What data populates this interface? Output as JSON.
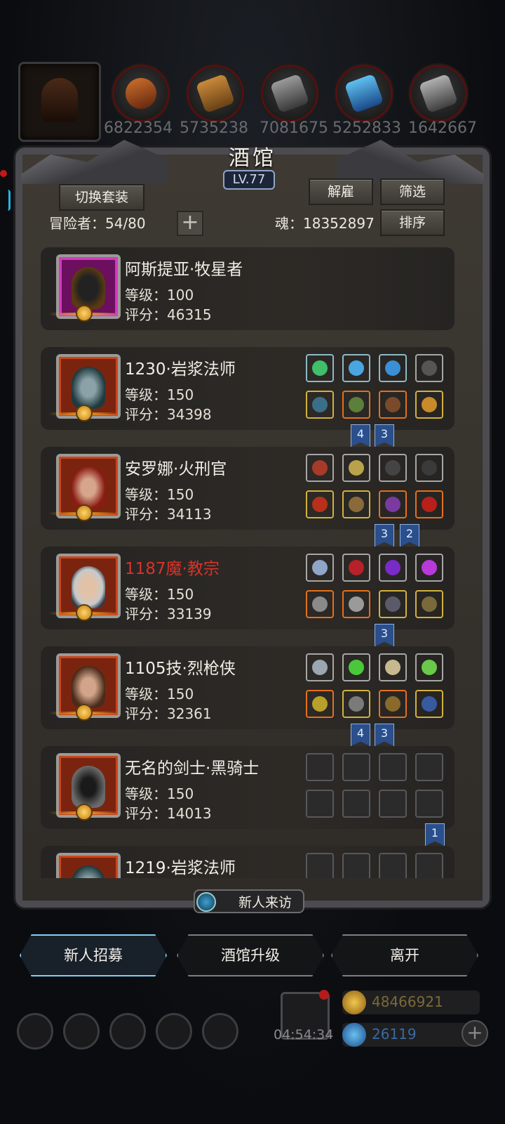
{
  "resources": {
    "values": [
      "6822354",
      "5735238",
      "7081675",
      "5252833",
      "1642667"
    ]
  },
  "panel": {
    "title": "酒馆",
    "level": "LV.77",
    "switch_outfit": "切换套装",
    "dismiss": "解雇",
    "filter": "筛选",
    "sort": "排序",
    "adventurer_label": "冒险者：54/80",
    "soul_label": "魂：18352897",
    "add_symbol": "+"
  },
  "heroes": [
    {
      "name": "阿斯提亚·牧星者",
      "level": "等级：100",
      "score": "评分：46315",
      "name_color": "#f2eee6",
      "frame": "magenta",
      "equipment": []
    },
    {
      "name": "1230·岩浆法师",
      "level": "等级：150",
      "score": "评分：34398",
      "name_color": "#f2eee6",
      "frame": "orange",
      "flags": [
        "4",
        "3"
      ]
    },
    {
      "name": "安罗娜·火刑官",
      "level": "等级：150",
      "score": "评分：34113",
      "name_color": "#f2eee6",
      "frame": "orange",
      "flags": [
        "3",
        "2"
      ]
    },
    {
      "name": "1187魔·教宗",
      "level": "等级：150",
      "score": "评分：33139",
      "name_color": "#d8332a",
      "frame": "orange",
      "flags": [
        "3"
      ]
    },
    {
      "name": "1105技·烈枪侠",
      "level": "等级：150",
      "score": "评分：32361",
      "name_color": "#f2eee6",
      "frame": "orange",
      "flags": [
        "4",
        "3"
      ]
    },
    {
      "name": "无名的剑士·黑骑士",
      "level": "等级：150",
      "score": "评分：14013",
      "name_color": "#f2eee6",
      "frame": "orange",
      "flags": [
        "1"
      ]
    },
    {
      "name": "1219·岩浆法师",
      "level": "",
      "score": "",
      "name_color": "#f2eee6",
      "frame": "orange",
      "flags": []
    }
  ],
  "visit_button": "新人来访",
  "actions": {
    "recruit": "新人招募",
    "upgrade": "酒馆升级",
    "leave": "离开"
  },
  "bottom": {
    "timer": "04:54:34",
    "gold": "48466921",
    "gems": "26119"
  },
  "colors": {
    "accent_blue": "#48b4e8",
    "name_red": "#d8332a",
    "flag_blue": "#2a4f8c"
  }
}
